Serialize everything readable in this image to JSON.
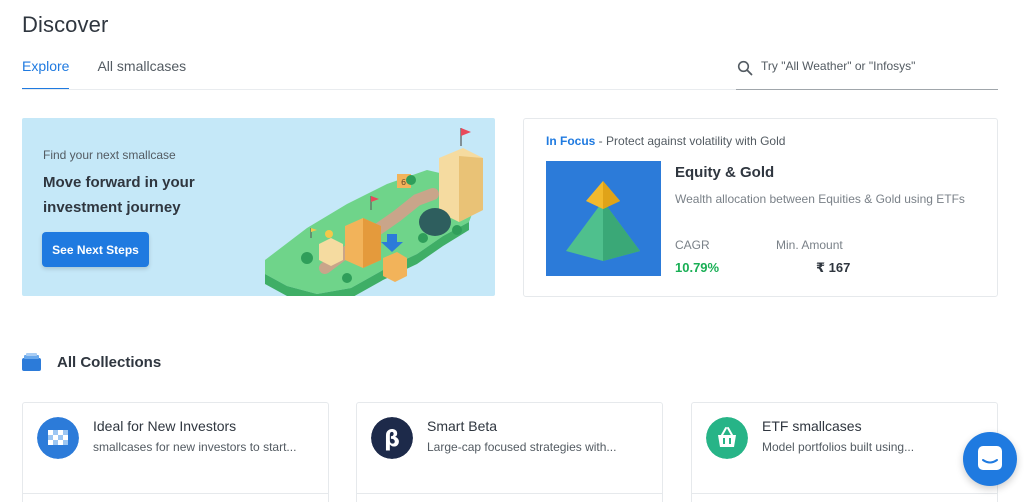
{
  "page": {
    "title": "Discover"
  },
  "tabs": [
    {
      "label": "Explore",
      "active": true
    },
    {
      "label": "All smallcases",
      "active": false
    }
  ],
  "search": {
    "placeholder": "Try \"All Weather\" or \"Infosys\"",
    "icon": "search-icon"
  },
  "banner": {
    "eyebrow": "Find your next smallcase",
    "heading": "Move forward in your investment journey",
    "button_label": "See Next Steps",
    "illustration_number": "6"
  },
  "focus": {
    "tag": "In Focus",
    "separator": " - ",
    "tagline": "Protect against volatility with Gold",
    "name": "Equity & Gold",
    "description": "Wealth allocation between Equities & Gold using ETFs",
    "cagr_label": "CAGR",
    "cagr_value": "10.79%",
    "min_amount_label": "Min. Amount",
    "min_amount_value": "₹ 167"
  },
  "collections": {
    "title": "All Collections",
    "items": [
      {
        "title": "Ideal for New Investors",
        "subtitle": "smallcases for new investors to start...",
        "icon": "checkered-flag-icon",
        "color": "#2c7bd9"
      },
      {
        "title": "Smart Beta",
        "subtitle": "Large-cap focused strategies with...",
        "icon": "beta-icon",
        "color": "#1d2a4a"
      },
      {
        "title": "ETF smallcases",
        "subtitle": "Model portfolios built using...",
        "icon": "basket-icon",
        "color": "#27b487"
      }
    ]
  },
  "colors": {
    "accent": "#1f7ae0",
    "positive": "#19af55",
    "banner_bg": "#c5e8f8"
  }
}
